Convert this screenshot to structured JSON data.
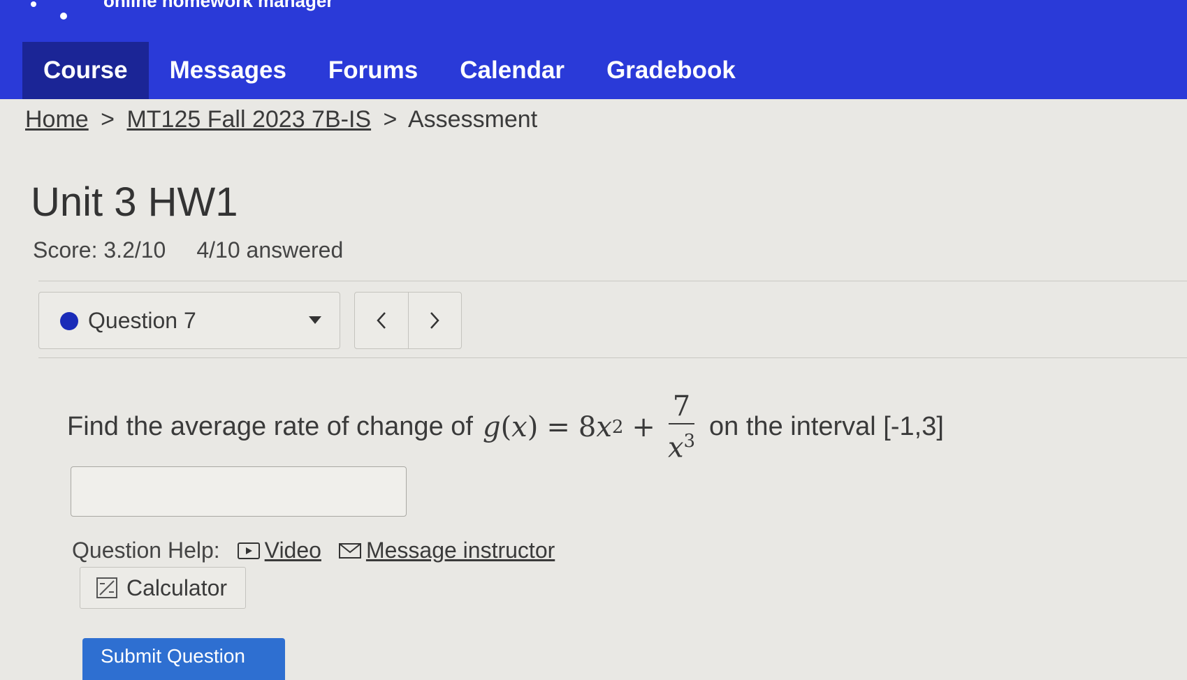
{
  "header": {
    "brand": "online homework manager",
    "nav": [
      {
        "label": "Course",
        "active": true
      },
      {
        "label": "Messages",
        "active": false
      },
      {
        "label": "Forums",
        "active": false
      },
      {
        "label": "Calendar",
        "active": false
      },
      {
        "label": "Gradebook",
        "active": false
      }
    ]
  },
  "breadcrumb": {
    "home": "Home",
    "course": "MT125 Fall 2023 7B-IS",
    "current": "Assessment",
    "separator": ">"
  },
  "assessment": {
    "title": "Unit 3 HW1",
    "score": "Score: 3.2/10",
    "answered": "4/10 answered"
  },
  "question_nav": {
    "selected": "Question 7",
    "prev_icon": "chevron-left-icon",
    "next_icon": "chevron-right-icon",
    "dot_color": "#1a2bb8"
  },
  "question": {
    "prompt": "Find the average rate of change of",
    "math": {
      "lhs_fn": "g",
      "lhs_var": "x",
      "equals": "=",
      "coef": "8",
      "var": "x",
      "exp": "2",
      "plus": "+",
      "frac_num": "7",
      "frac_den_var": "x",
      "frac_den_exp": "3"
    },
    "suffix": "on the interval [-1,3]",
    "answer_value": ""
  },
  "help": {
    "label": "Question Help:",
    "video": "Video",
    "message": "Message instructor",
    "calculator": "Calculator"
  },
  "submit": {
    "label": "Submit Question"
  },
  "colors": {
    "nav_bg": "#2a3ad8",
    "nav_active": "#1b2596",
    "submit_bg": "#2e6fd1"
  }
}
